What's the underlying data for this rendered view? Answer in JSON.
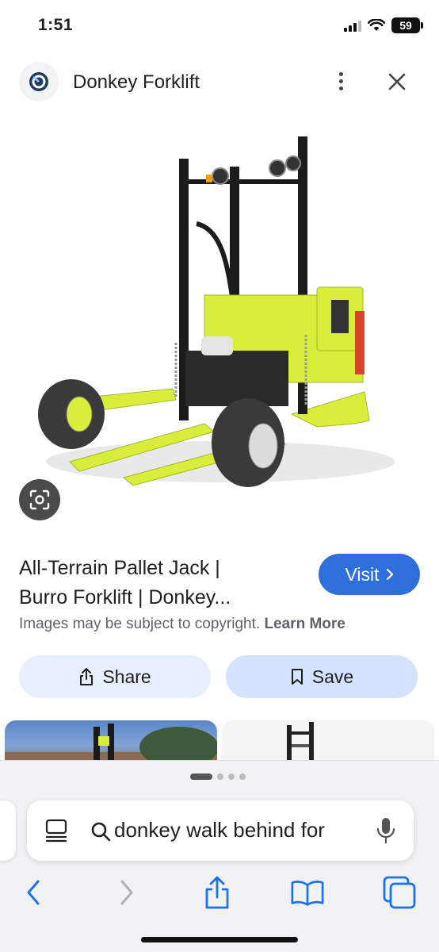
{
  "status_bar": {
    "time": "1:51",
    "battery": "59"
  },
  "header": {
    "title": "Donkey Forklift"
  },
  "result": {
    "title_line1": "All-Terrain Pallet Jack |",
    "title_line2": "Burro Forklift | Donkey...",
    "visit_label": "Visit",
    "copyright_text": "Images may be subject to copyright.",
    "learn_more": "Learn More",
    "share_label": "Share",
    "save_label": "Save"
  },
  "browser": {
    "address_text": "donkey walk behind for",
    "tab_pages": 4,
    "active_page": 1
  },
  "colors": {
    "accent": "#2f6fdc",
    "share_bg": "#e8effc",
    "save_bg": "#d3e3fd",
    "toolbar_blue": "#1a73e8",
    "forklift_yellow": "#d9ee3a"
  },
  "icons": [
    "lens-logo-icon",
    "more-vert-icon",
    "close-icon",
    "lens-search-icon",
    "chevron-right-icon",
    "share-icon",
    "bookmark-icon",
    "reader-icon",
    "search-icon",
    "mic-icon",
    "back-icon",
    "forward-icon",
    "share-sheet-icon",
    "bookmarks-icon",
    "tabs-icon"
  ]
}
